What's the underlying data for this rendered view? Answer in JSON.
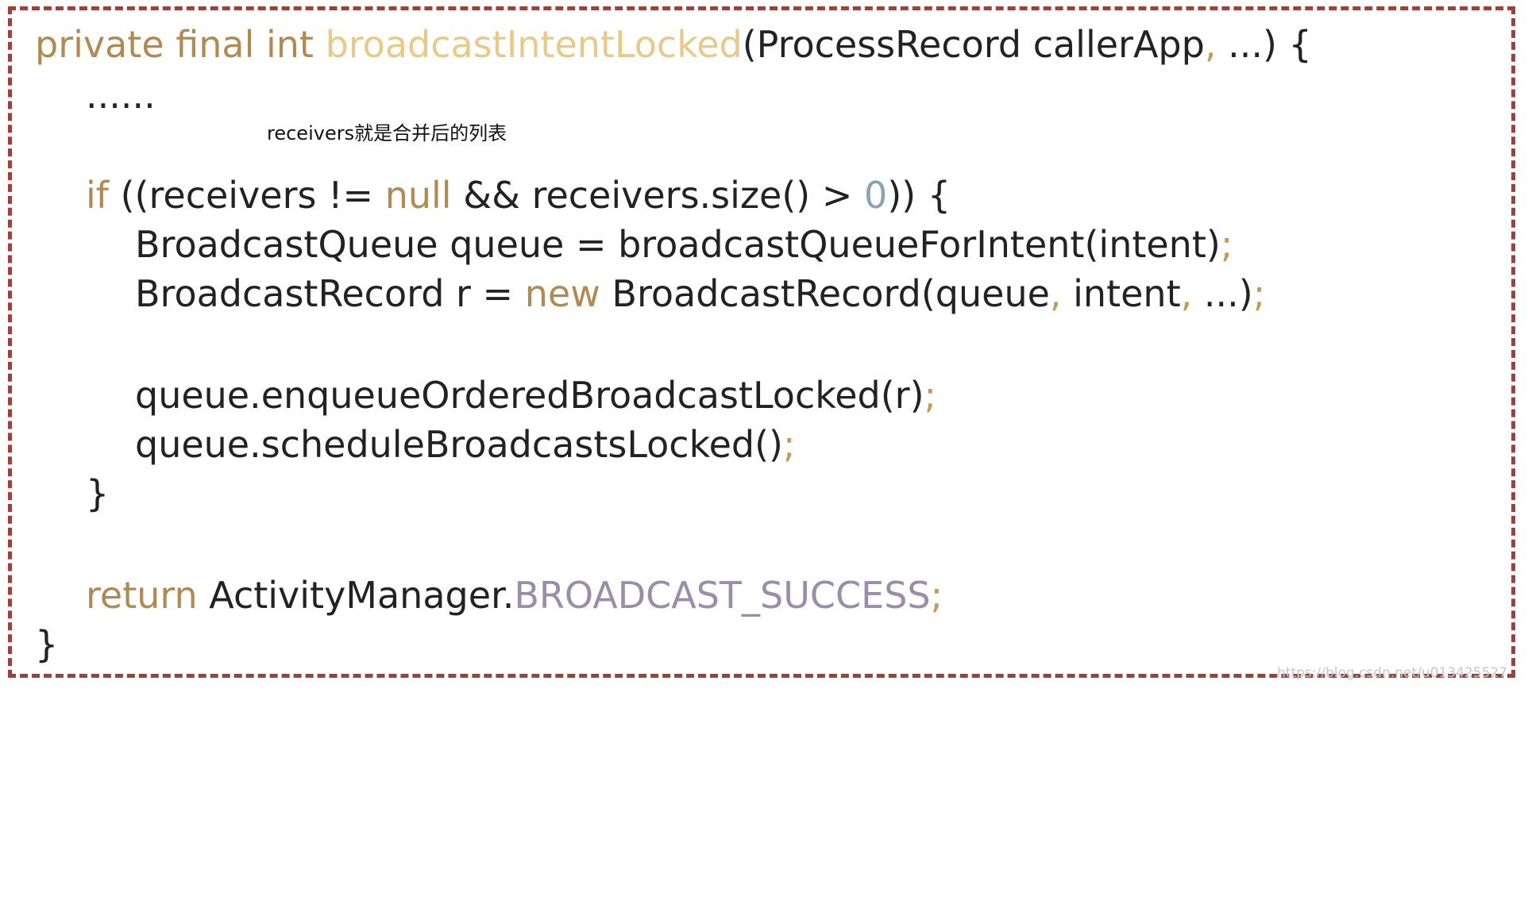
{
  "code": {
    "line1": {
      "kw": "private final int ",
      "fn": "broadcastIntentLocked",
      "rest": "(ProcessRecord callerApp",
      "comma": ",",
      "tail": " ...) {"
    },
    "line2": "......",
    "line3": {
      "kw_if": "if",
      "a": " ((receivers != ",
      "kw_null": "null",
      "b": " && receivers.size() > ",
      "num": "0",
      "c": ")) {"
    },
    "line4": {
      "text": "BroadcastQueue queue = broadcastQueueForIntent(intent)",
      "semi": ";"
    },
    "line5": {
      "a": "BroadcastRecord r = ",
      "kw_new": "new",
      "b": " BroadcastRecord(queue",
      "comma1": ",",
      "c": " intent",
      "comma2": ",",
      "d": " ...)",
      "semi": ";"
    },
    "line6": {
      "text": "queue.enqueueOrderedBroadcastLocked(r)",
      "semi": ";"
    },
    "line7": {
      "text": "queue.scheduleBroadcastsLocked()",
      "semi": ";"
    },
    "line8": "}",
    "line9": {
      "kw_return": "return",
      "a": " ActivityManager.",
      "const": "BROADCAST_SUCCESS",
      "semi": ";"
    },
    "line10": "}"
  },
  "annotation": "receivers就是合并后的列表",
  "watermark": "https://blog.csdn.net/u013425527",
  "colors": {
    "frame_border": "#a0403a",
    "keyword": "#b08a52",
    "function_name": "#e8c98a",
    "number": "#8aa2b8",
    "constant": "#9b8cab",
    "text": "#222222"
  }
}
